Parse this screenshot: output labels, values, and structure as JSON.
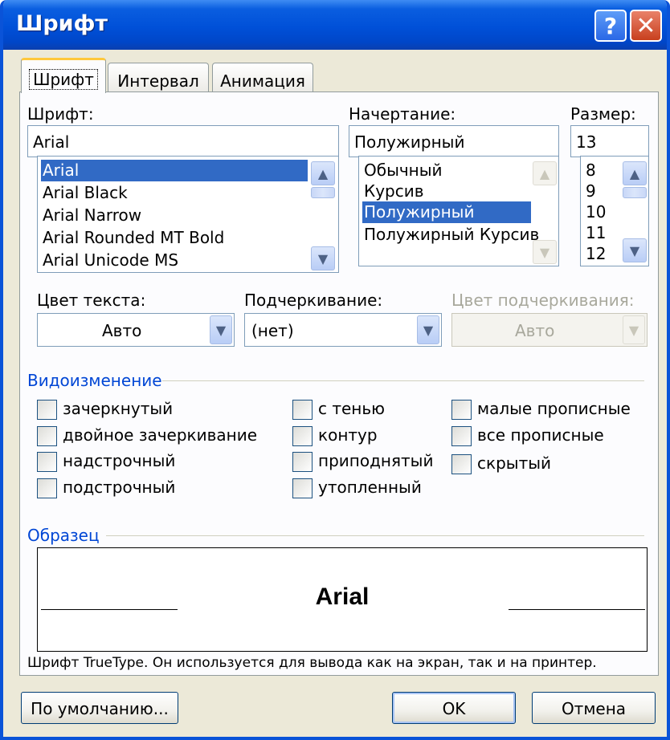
{
  "window": {
    "title": "Шрифт",
    "help_label": "?",
    "close_label": "✕"
  },
  "tabs": [
    {
      "label": "Шрифт",
      "active": true
    },
    {
      "label": "Интервал",
      "active": false
    },
    {
      "label": "Анимация",
      "active": false
    }
  ],
  "font": {
    "label": "Шрифт:",
    "value": "Arial",
    "items": [
      "Arial",
      "Arial Black",
      "Arial Narrow",
      "Arial Rounded MT Bold",
      "Arial Unicode MS"
    ],
    "selected": "Arial"
  },
  "style": {
    "label": "Начертание:",
    "value": "Полужирный",
    "items": [
      "Обычный",
      "Курсив",
      "Полужирный",
      "Полужирный Курсив"
    ],
    "selected": "Полужирный"
  },
  "size": {
    "label": "Размер:",
    "value": "13",
    "items": [
      "8",
      "9",
      "10",
      "11",
      "12"
    ]
  },
  "text_color": {
    "label": "Цвет текста:",
    "value": "Авто"
  },
  "underline": {
    "label": "Подчеркивание:",
    "value": "(нет)"
  },
  "underline_color": {
    "label": "Цвет подчеркивания:",
    "value": "Авто",
    "disabled": true
  },
  "effects": {
    "title": "Видоизменение",
    "items": [
      {
        "label": "зачеркнутый",
        "checked": false
      },
      {
        "label": "двойное зачеркивание",
        "checked": false
      },
      {
        "label": "надстрочный",
        "checked": false
      },
      {
        "label": "подстрочный",
        "checked": false
      },
      {
        "label": "с тенью",
        "checked": false
      },
      {
        "label": "контур",
        "checked": false
      },
      {
        "label": "приподнятый",
        "checked": false
      },
      {
        "label": "утопленный",
        "checked": false
      },
      {
        "label": "малые прописные",
        "checked": false
      },
      {
        "label": "все прописные",
        "checked": false
      },
      {
        "label": "скрытый",
        "checked": false
      }
    ]
  },
  "preview": {
    "title": "Образец",
    "sample": "Arial",
    "info": "Шрифт TrueType. Он используется для вывода как на экран, так и на принтер."
  },
  "buttons": {
    "default": "По умолчанию...",
    "ok": "OK",
    "cancel": "Отмена"
  },
  "colors": {
    "titlebar": "#0050d8",
    "selection": "#316ac5",
    "group_title": "#0046d5",
    "dialog_bg": "#ece9d8"
  }
}
